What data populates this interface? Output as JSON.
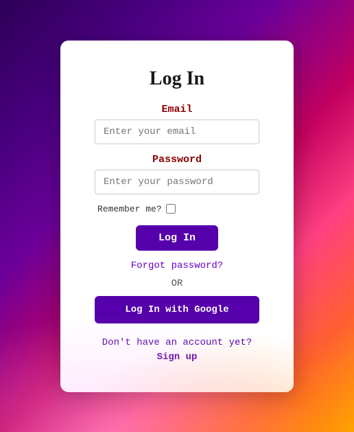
{
  "card": {
    "title": "Log In",
    "email": {
      "label": "Email",
      "placeholder": "Enter your email"
    },
    "password": {
      "label": "Password",
      "placeholder": "Enter your password"
    },
    "remember": {
      "label": "Remember me?"
    },
    "login_button": "Log In",
    "forgot_password": "Forgot password?",
    "or_text": "OR",
    "google_button": "Log In with Google",
    "no_account_text": "Don't have an account yet?",
    "signup_link": "Sign up"
  }
}
